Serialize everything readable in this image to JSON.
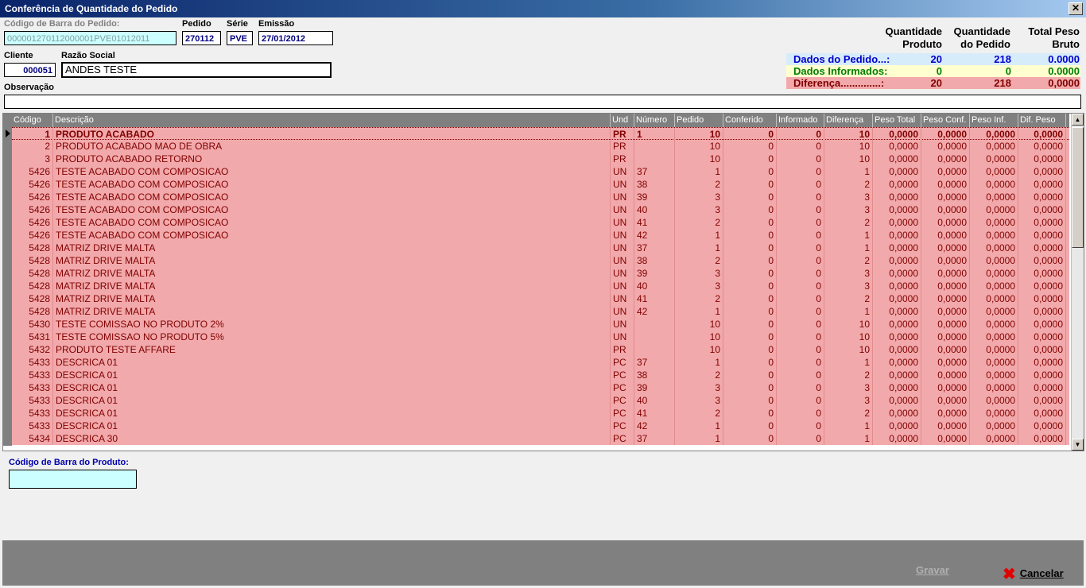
{
  "window": {
    "title": "Conferência de Quantidade do Pedido",
    "close": "✕"
  },
  "header": {
    "barcode_label": "Código de Barra do Pedido:",
    "barcode_value": "000001270112000001PVE01012011",
    "pedido_label": "Pedido",
    "pedido_value": "270112",
    "serie_label": "Série",
    "serie_value": "PVE",
    "emissao_label": "Emissão",
    "emissao_value": "27/01/2012",
    "cliente_label": "Cliente",
    "cliente_value": "000051",
    "razao_label": "Razão Social",
    "razao_value": "ANDES TESTE",
    "obs_label": "Observação",
    "obs_value": ""
  },
  "summary": {
    "col1": "Quantidade Produto",
    "col1_a": "Quantidade",
    "col1_b": "Produto",
    "col2_a": "Quantidade",
    "col2_b": "do Pedido",
    "col3_a": "Total Peso",
    "col3_b": "Bruto",
    "rows": [
      {
        "label": "Dados do Pedido...:",
        "v1": "20",
        "v2": "218",
        "v3": "0.0000",
        "bg": "#d7ecfb",
        "color": "#0000cc"
      },
      {
        "label": "Dados Informados:",
        "v1": "0",
        "v2": "0",
        "v3": "0.0000",
        "bg": "#ffffd0",
        "color": "#008000"
      },
      {
        "label": "Diferença..............:",
        "v1": "20",
        "v2": "218",
        "v3": "0,0000",
        "bg": "#f2a9ab",
        "color": "#800000"
      }
    ]
  },
  "grid": {
    "columns": [
      "Código",
      "Descrição",
      "Und",
      "Número",
      "Pedido",
      "Conferido",
      "Informado",
      "Diferença",
      "Peso Total",
      "Peso Conf.",
      "Peso Inf.",
      "Dif. Peso"
    ],
    "rows": [
      [
        "1",
        "PRODUTO ACABADO",
        "PR",
        "1",
        "10",
        "0",
        "0",
        "10",
        "0,0000",
        "0,0000",
        "0,0000",
        "0,0000"
      ],
      [
        "2",
        "PRODUTO ACABADO MAO DE OBRA",
        "PR",
        "",
        "10",
        "0",
        "0",
        "10",
        "0,0000",
        "0,0000",
        "0,0000",
        "0,0000"
      ],
      [
        "3",
        "PRODUTO ACABADO RETORNO",
        "PR",
        "",
        "10",
        "0",
        "0",
        "10",
        "0,0000",
        "0,0000",
        "0,0000",
        "0,0000"
      ],
      [
        "5426",
        "TESTE ACABADO COM COMPOSICAO",
        "UN",
        "37",
        "1",
        "0",
        "0",
        "1",
        "0,0000",
        "0,0000",
        "0,0000",
        "0,0000"
      ],
      [
        "5426",
        "TESTE ACABADO COM COMPOSICAO",
        "UN",
        "38",
        "2",
        "0",
        "0",
        "2",
        "0,0000",
        "0,0000",
        "0,0000",
        "0,0000"
      ],
      [
        "5426",
        "TESTE ACABADO COM COMPOSICAO",
        "UN",
        "39",
        "3",
        "0",
        "0",
        "3",
        "0,0000",
        "0,0000",
        "0,0000",
        "0,0000"
      ],
      [
        "5426",
        "TESTE ACABADO COM COMPOSICAO",
        "UN",
        "40",
        "3",
        "0",
        "0",
        "3",
        "0,0000",
        "0,0000",
        "0,0000",
        "0,0000"
      ],
      [
        "5426",
        "TESTE ACABADO COM COMPOSICAO",
        "UN",
        "41",
        "2",
        "0",
        "0",
        "2",
        "0,0000",
        "0,0000",
        "0,0000",
        "0,0000"
      ],
      [
        "5426",
        "TESTE ACABADO COM COMPOSICAO",
        "UN",
        "42",
        "1",
        "0",
        "0",
        "1",
        "0,0000",
        "0,0000",
        "0,0000",
        "0,0000"
      ],
      [
        "5428",
        "MATRIZ DRIVE MALTA",
        "UN",
        "37",
        "1",
        "0",
        "0",
        "1",
        "0,0000",
        "0,0000",
        "0,0000",
        "0,0000"
      ],
      [
        "5428",
        "MATRIZ DRIVE MALTA",
        "UN",
        "38",
        "2",
        "0",
        "0",
        "2",
        "0,0000",
        "0,0000",
        "0,0000",
        "0,0000"
      ],
      [
        "5428",
        "MATRIZ DRIVE MALTA",
        "UN",
        "39",
        "3",
        "0",
        "0",
        "3",
        "0,0000",
        "0,0000",
        "0,0000",
        "0,0000"
      ],
      [
        "5428",
        "MATRIZ DRIVE MALTA",
        "UN",
        "40",
        "3",
        "0",
        "0",
        "3",
        "0,0000",
        "0,0000",
        "0,0000",
        "0,0000"
      ],
      [
        "5428",
        "MATRIZ DRIVE MALTA",
        "UN",
        "41",
        "2",
        "0",
        "0",
        "2",
        "0,0000",
        "0,0000",
        "0,0000",
        "0,0000"
      ],
      [
        "5428",
        "MATRIZ DRIVE MALTA",
        "UN",
        "42",
        "1",
        "0",
        "0",
        "1",
        "0,0000",
        "0,0000",
        "0,0000",
        "0,0000"
      ],
      [
        "5430",
        "TESTE COMISSAO NO PRODUTO 2%",
        "UN",
        "",
        "10",
        "0",
        "0",
        "10",
        "0,0000",
        "0,0000",
        "0,0000",
        "0,0000"
      ],
      [
        "5431",
        "TESTE COMISSAO NO PRODUTO 5%",
        "UN",
        "",
        "10",
        "0",
        "0",
        "10",
        "0,0000",
        "0,0000",
        "0,0000",
        "0,0000"
      ],
      [
        "5432",
        "PRODUTO TESTE AFFARE",
        "PR",
        "",
        "10",
        "0",
        "0",
        "10",
        "0,0000",
        "0,0000",
        "0,0000",
        "0,0000"
      ],
      [
        "5433",
        "DESCRICA 01",
        "PC",
        "37",
        "1",
        "0",
        "0",
        "1",
        "0,0000",
        "0,0000",
        "0,0000",
        "0,0000"
      ],
      [
        "5433",
        "DESCRICA 01",
        "PC",
        "38",
        "2",
        "0",
        "0",
        "2",
        "0,0000",
        "0,0000",
        "0,0000",
        "0,0000"
      ],
      [
        "5433",
        "DESCRICA 01",
        "PC",
        "39",
        "3",
        "0",
        "0",
        "3",
        "0,0000",
        "0,0000",
        "0,0000",
        "0,0000"
      ],
      [
        "5433",
        "DESCRICA 01",
        "PC",
        "40",
        "3",
        "0",
        "0",
        "3",
        "0,0000",
        "0,0000",
        "0,0000",
        "0,0000"
      ],
      [
        "5433",
        "DESCRICA 01",
        "PC",
        "41",
        "2",
        "0",
        "0",
        "2",
        "0,0000",
        "0,0000",
        "0,0000",
        "0,0000"
      ],
      [
        "5433",
        "DESCRICA 01",
        "PC",
        "42",
        "1",
        "0",
        "0",
        "1",
        "0,0000",
        "0,0000",
        "0,0000",
        "0,0000"
      ],
      [
        "5434",
        "DESCRICA 30",
        "PC",
        "37",
        "1",
        "0",
        "0",
        "1",
        "0,0000",
        "0,0000",
        "0,0000",
        "0,0000"
      ]
    ]
  },
  "product_barcode": {
    "label": "Código de Barra do Produto:",
    "value": ""
  },
  "footer": {
    "save": "Gravar",
    "cancel": "Cancelar"
  },
  "icons": {
    "close": "close-icon",
    "cancel": "red-x-icon",
    "row_indicator": "triangle-right-icon"
  }
}
